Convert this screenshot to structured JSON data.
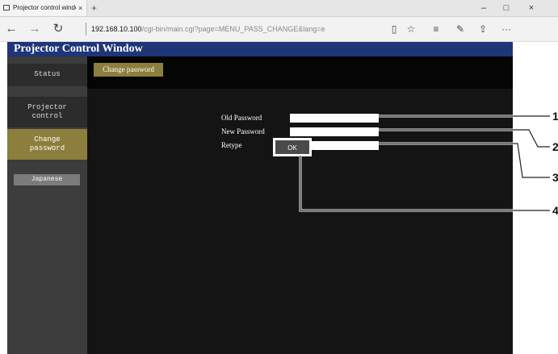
{
  "browser": {
    "tab_title": "Projector control window",
    "tab_close": "×",
    "new_tab": "+",
    "window_controls": {
      "minimize": "–",
      "maximize": "□",
      "close": "×"
    },
    "back": "←",
    "forward": "→",
    "refresh": "↻",
    "url_host": "192.168.10.100",
    "url_path": "/cgi-bin/main.cgi?page=MENU_PASS_CHANGE&lang=e",
    "toolbar_icons": [
      "reading-view-icon",
      "favorite-star-icon",
      "hub-icon",
      "web-note-icon",
      "share-icon",
      "more-icon"
    ],
    "toolbar_glyphs": {
      "reading": "▯",
      "star": "☆",
      "hub": "≡",
      "note": "✎",
      "share": "⇪",
      "more": "···"
    }
  },
  "page": {
    "header_title": "Projector Control Window",
    "sidebar": {
      "items": [
        {
          "label_lines": [
            "Status"
          ],
          "active": false
        },
        {
          "label_lines": [
            "Projector",
            "control"
          ],
          "active": false
        },
        {
          "label_lines": [
            "Change",
            "password"
          ],
          "active": true
        }
      ],
      "language_button": "Japanese"
    },
    "tab_button": "Change password",
    "form": {
      "old_password_label": "Old Password",
      "new_password_label": "New Password",
      "retype_label": "Retype",
      "old_password_value": "",
      "new_password_value": "",
      "retype_value": "",
      "ok_label": "OK"
    }
  },
  "callouts": [
    "1",
    "2",
    "3",
    "4"
  ],
  "colors": {
    "header_bg": "#1e3578",
    "active_item_bg": "#8c7e3c",
    "page_bg": "#131313"
  }
}
